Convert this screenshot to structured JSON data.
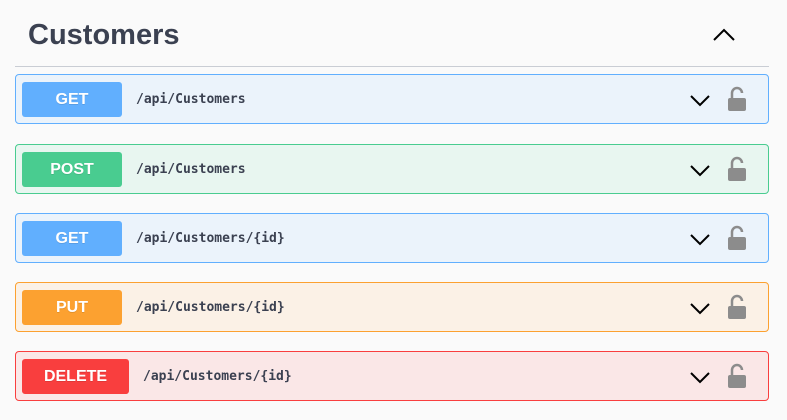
{
  "section": {
    "title": "Customers",
    "collapse_icon": "chevron-up-icon"
  },
  "operations": [
    {
      "method": "GET",
      "path": "/api/Customers",
      "color": "#61affe",
      "background": "#ebf3fb"
    },
    {
      "method": "POST",
      "path": "/api/Customers",
      "color": "#49cc90",
      "background": "#e8f6f0"
    },
    {
      "method": "GET",
      "path": "/api/Customers/{id}",
      "color": "#61affe",
      "background": "#ebf3fb"
    },
    {
      "method": "PUT",
      "path": "/api/Customers/{id}",
      "color": "#fca130",
      "background": "#fbf1e6"
    },
    {
      "method": "DELETE",
      "path": "/api/Customers/{id}",
      "color": "#f93e3e",
      "background": "#fae7e7"
    }
  ],
  "icons": {
    "expand": "chevron-down-icon",
    "authorize": "unlocked-padlock-icon"
  }
}
